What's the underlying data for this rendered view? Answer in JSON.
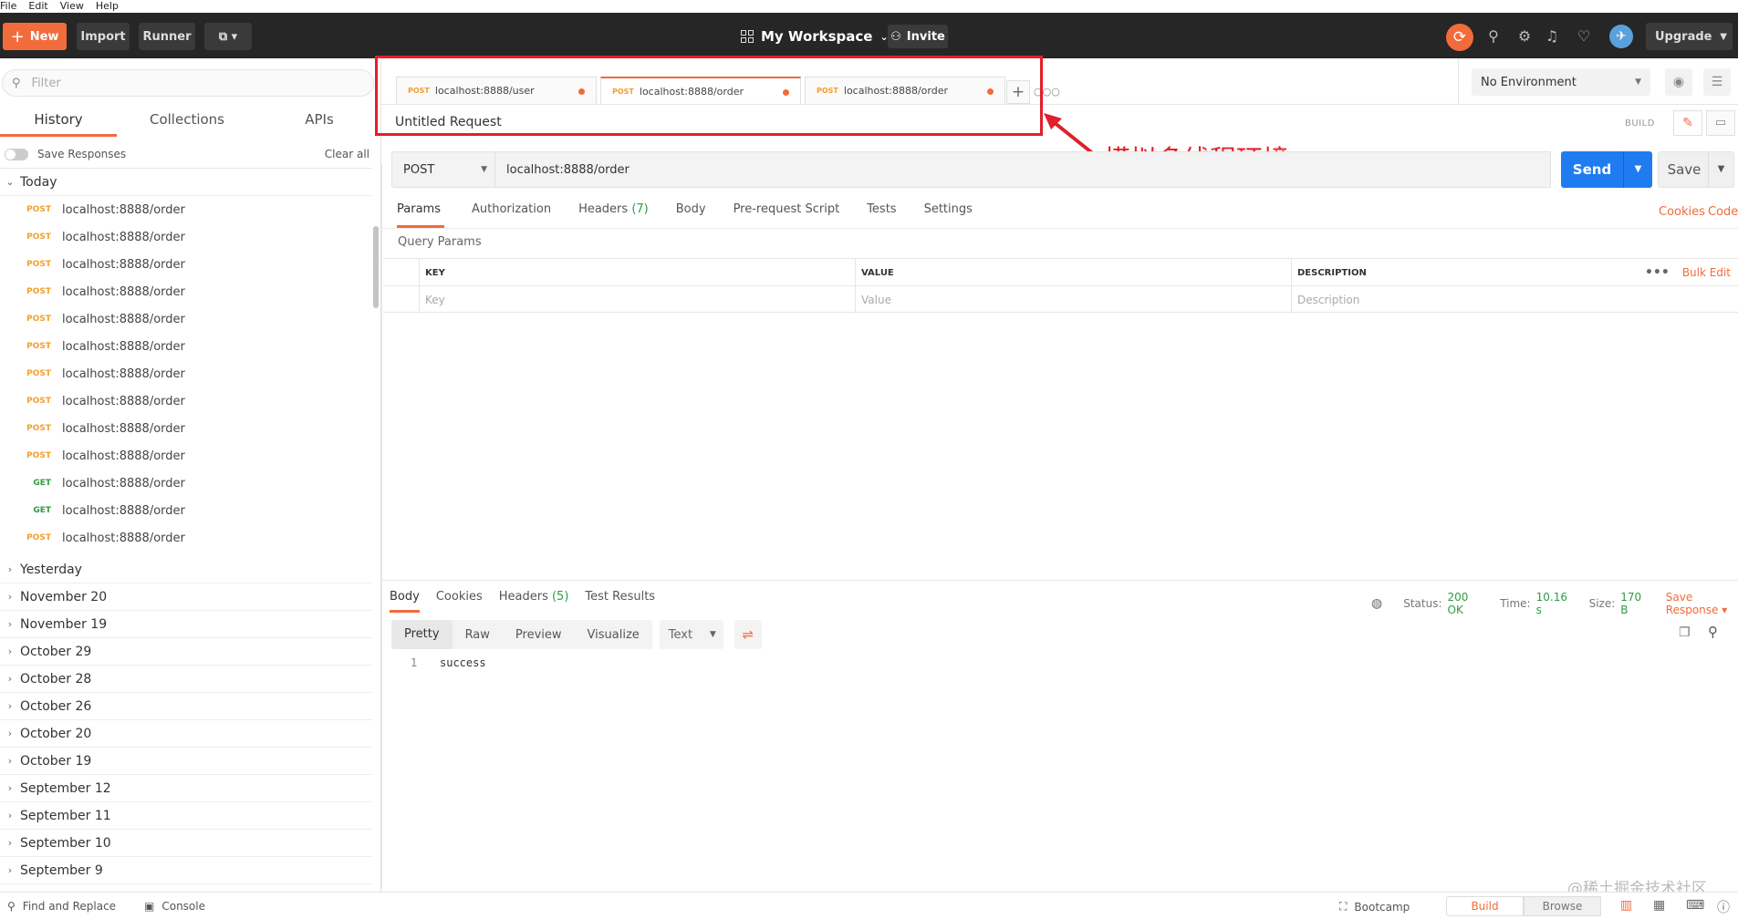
{
  "menu": [
    "File",
    "Edit",
    "View",
    "Help"
  ],
  "topbar": {
    "new_label": "New",
    "import_label": "Import",
    "runner_label": "Runner",
    "workspace_label": "My Workspace",
    "invite_label": "Invite",
    "upgrade_label": "Upgrade"
  },
  "sidebar": {
    "filter_placeholder": "Filter",
    "tabs": [
      "History",
      "Collections",
      "APIs"
    ],
    "save_responses_label": "Save Responses",
    "clear_all_label": "Clear all",
    "today_label": "Today",
    "today_items": [
      {
        "method": "POST",
        "url": "localhost:8888/order"
      },
      {
        "method": "POST",
        "url": "localhost:8888/order"
      },
      {
        "method": "POST",
        "url": "localhost:8888/order"
      },
      {
        "method": "POST",
        "url": "localhost:8888/order"
      },
      {
        "method": "POST",
        "url": "localhost:8888/order"
      },
      {
        "method": "POST",
        "url": "localhost:8888/order"
      },
      {
        "method": "POST",
        "url": "localhost:8888/order"
      },
      {
        "method": "POST",
        "url": "localhost:8888/order"
      },
      {
        "method": "POST",
        "url": "localhost:8888/order"
      },
      {
        "method": "POST",
        "url": "localhost:8888/order"
      },
      {
        "method": "GET",
        "url": "localhost:8888/order"
      },
      {
        "method": "GET",
        "url": "localhost:8888/order"
      },
      {
        "method": "POST",
        "url": "localhost:8888/order"
      }
    ],
    "groups": [
      "Yesterday",
      "November 20",
      "November 19",
      "October 29",
      "October 28",
      "October 26",
      "October 20",
      "October 19",
      "September 12",
      "September 11",
      "September 10",
      "September 9"
    ]
  },
  "request_tabs": [
    {
      "method": "POST",
      "url": "localhost:8888/user"
    },
    {
      "method": "POST",
      "url": "localhost:8888/order"
    },
    {
      "method": "POST",
      "url": "localhost:8888/order"
    }
  ],
  "annotation_text": "模拟多线程环境",
  "environment": {
    "selected": "No Environment"
  },
  "request": {
    "name": "Untitled Request",
    "build_label": "BUILD",
    "method": "POST",
    "url": "localhost:8888/order",
    "send_label": "Send",
    "save_label": "Save",
    "tabs": {
      "params": "Params",
      "authorization": "Authorization",
      "headers": "Headers",
      "headers_count": "(7)",
      "body": "Body",
      "prerequest": "Pre-request Script",
      "tests": "Tests",
      "settings": "Settings"
    },
    "cookies_label": "Cookies",
    "code_label": "Code",
    "query_params_title": "Query Params",
    "table_headers": {
      "key": "KEY",
      "value": "VALUE",
      "description": "DESCRIPTION",
      "bulk_edit": "Bulk Edit"
    },
    "table_placeholders": {
      "key": "Key",
      "value": "Value",
      "description": "Description"
    }
  },
  "response": {
    "tabs": {
      "body": "Body",
      "cookies": "Cookies",
      "headers": "Headers",
      "headers_count": "(5)",
      "test_results": "Test Results"
    },
    "status_label": "Status:",
    "status_value": "200 OK",
    "time_label": "Time:",
    "time_value": "10.16 s",
    "size_label": "Size:",
    "size_value": "170 B",
    "save_response_label": "Save Response",
    "formats": [
      "Pretty",
      "Raw",
      "Preview",
      "Visualize"
    ],
    "type_selected": "Text",
    "line_number": "1",
    "body_text": "success"
  },
  "statusbar": {
    "find_replace": "Find and Replace",
    "console": "Console",
    "bootcamp": "Bootcamp",
    "build": "Build",
    "browse": "Browse"
  },
  "watermark": "@稀土掘金技术社区",
  "colors": {
    "accent": "#f26b3a",
    "send": "#1f7cf0",
    "post": "#f0a030",
    "get": "#2e9b44",
    "annotation": "#e0202a"
  }
}
